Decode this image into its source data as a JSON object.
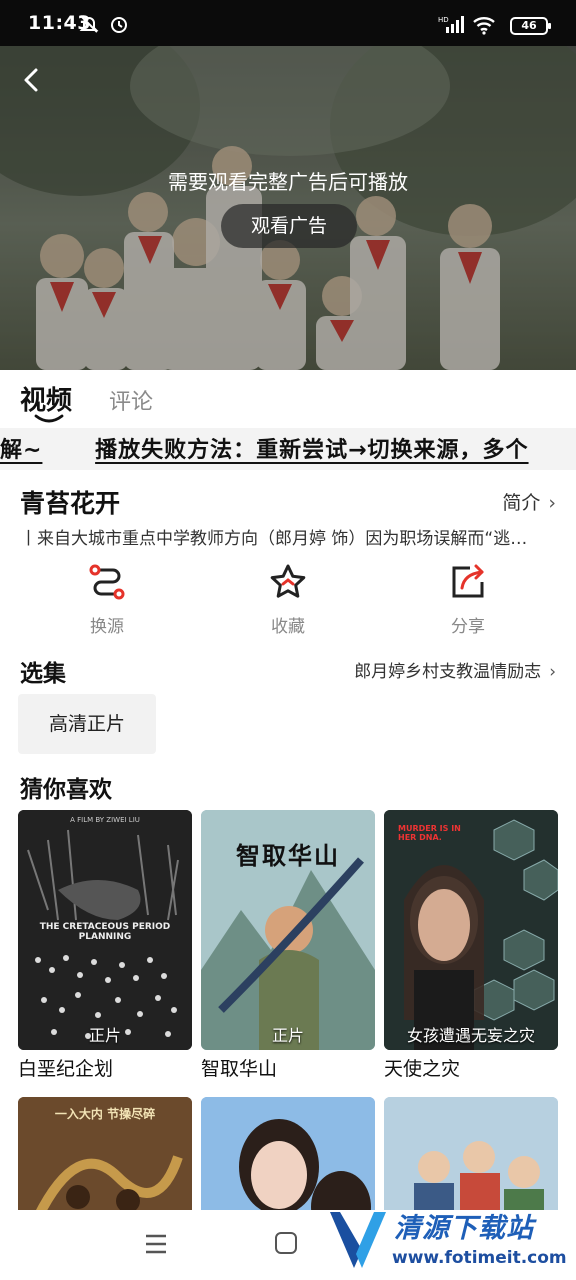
{
  "status_bar": {
    "time": "11:43",
    "battery": "46"
  },
  "player": {
    "ad_message": "需要观看完整广告后可播放",
    "ad_button": "观看广告"
  },
  "tabs": [
    {
      "label": "视频",
      "active": true
    },
    {
      "label": "评论",
      "active": false
    }
  ],
  "notice": {
    "lead": "解~",
    "text": "播放失败方法：重新尝试→切换来源，多个"
  },
  "movie": {
    "title": "青苔花开",
    "intro_link": "简介",
    "description": "丨来自大城市重点中学教师方向（郎月婷 饰）因为职场误解而“逃…"
  },
  "actions": [
    {
      "label": "换源",
      "icon": "switch-source-icon"
    },
    {
      "label": "收藏",
      "icon": "star-icon"
    },
    {
      "label": "分享",
      "icon": "share-icon"
    }
  ],
  "episodes": {
    "heading": "选集",
    "subtitle": "郎月婷乡村支教温情励志",
    "items": [
      "高清正片"
    ]
  },
  "recommend": {
    "heading": "猜你喜欢",
    "items": [
      {
        "title": "白垩纪企划",
        "tag": "正片",
        "poster_text": "THE CRETACEOUS PERIOD PLANNING",
        "poster_top": "A FILM BY ZIWEI LIU"
      },
      {
        "title": "智取华山",
        "tag": "正片",
        "poster_text": "智取华山"
      },
      {
        "title": "天使之灾",
        "tag": "女孩遭遇无妄之灾",
        "poster_text": "MURDER IS IN HER DNA."
      }
    ],
    "row2": [
      {
        "poster_text": "一入大内 节操尽碎"
      },
      {
        "poster_text": ""
      },
      {
        "poster_text": ""
      }
    ]
  },
  "watermark": {
    "name": "清源下载站",
    "url": "www.fotimeit.com"
  },
  "colors": {
    "accent": "#e5332a",
    "link_icon": "#222222"
  }
}
